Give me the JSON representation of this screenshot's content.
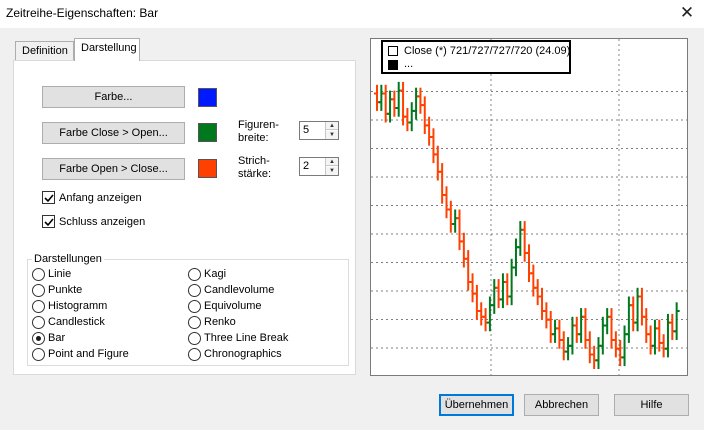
{
  "window": {
    "title": "Zeitreihe-Eigenschaften: Bar"
  },
  "tabs": [
    {
      "label": "Definition"
    },
    {
      "label": "Darstellung"
    }
  ],
  "colors": [
    {
      "button": "Farbe...",
      "swatch": "#0019ff"
    },
    {
      "button": "Farbe Close > Open...",
      "swatch": "#00781e"
    },
    {
      "button": "Farbe Open > Close...",
      "swatch": "#ff4000"
    }
  ],
  "figure_width": {
    "label_line1": "Figuren-",
    "label_line2": "breite:",
    "value": "5"
  },
  "stroke_width": {
    "label_line1": "Strich-",
    "label_line2": "stärke:",
    "value": "2"
  },
  "checkboxes": [
    {
      "label": "Anfang anzeigen",
      "checked": true
    },
    {
      "label": "Schluss anzeigen",
      "checked": true
    }
  ],
  "representations": {
    "legend": "Darstellungen",
    "left": [
      "Linie",
      "Punkte",
      "Histogramm",
      "Candlestick",
      "Bar",
      "Point and Figure"
    ],
    "right": [
      "Kagi",
      "Candlevolume",
      "Equivolume",
      "Renko",
      "Three Line Break",
      "Chronographics"
    ],
    "selected": "Bar"
  },
  "preview": {
    "legend_line1": "Close (*) 721/727/727/720 (24.09)",
    "legend_line2": "...",
    "up_color": "#00781e",
    "down_color": "#ff4000"
  },
  "chart_data": {
    "type": "ohlc-bar",
    "title": "",
    "xlabel": "",
    "ylabel": "",
    "up_color": "#00781e",
    "down_color": "#ff4000",
    "grid": true,
    "ylim": [
      0,
      100
    ],
    "close": [
      92,
      95,
      88,
      93,
      90,
      96,
      87,
      85,
      89,
      94,
      91,
      84,
      80,
      74,
      68,
      60,
      55,
      50,
      52,
      44,
      38,
      30,
      26,
      20,
      18,
      16,
      22,
      28,
      24,
      30,
      25,
      35,
      42,
      48,
      40,
      33,
      28,
      25,
      20,
      17,
      12,
      14,
      10,
      6,
      8,
      15,
      12,
      18,
      10,
      5,
      3,
      8,
      15,
      18,
      10,
      7,
      4,
      12,
      22,
      16,
      25,
      18,
      12,
      8,
      14,
      9,
      7,
      16,
      13,
      20
    ],
    "x": [],
    "y": []
  },
  "footer": {
    "apply": "Übernehmen",
    "cancel": "Abbrechen",
    "help": "Hilfe"
  }
}
